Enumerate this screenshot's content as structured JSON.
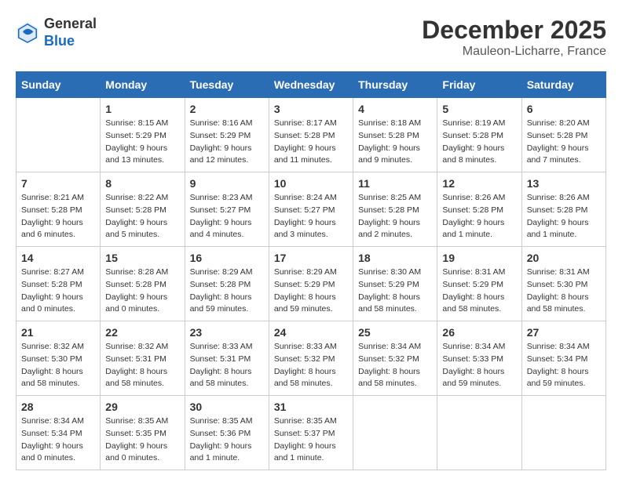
{
  "header": {
    "logo": {
      "general": "General",
      "blue": "Blue"
    },
    "month_title": "December 2025",
    "subtitle": "Mauleon-Licharre, France"
  },
  "days_of_week": [
    "Sunday",
    "Monday",
    "Tuesday",
    "Wednesday",
    "Thursday",
    "Friday",
    "Saturday"
  ],
  "weeks": [
    [
      {
        "day": "",
        "info": ""
      },
      {
        "day": "1",
        "info": "Sunrise: 8:15 AM\nSunset: 5:29 PM\nDaylight: 9 hours\nand 13 minutes."
      },
      {
        "day": "2",
        "info": "Sunrise: 8:16 AM\nSunset: 5:29 PM\nDaylight: 9 hours\nand 12 minutes."
      },
      {
        "day": "3",
        "info": "Sunrise: 8:17 AM\nSunset: 5:28 PM\nDaylight: 9 hours\nand 11 minutes."
      },
      {
        "day": "4",
        "info": "Sunrise: 8:18 AM\nSunset: 5:28 PM\nDaylight: 9 hours\nand 9 minutes."
      },
      {
        "day": "5",
        "info": "Sunrise: 8:19 AM\nSunset: 5:28 PM\nDaylight: 9 hours\nand 8 minutes."
      },
      {
        "day": "6",
        "info": "Sunrise: 8:20 AM\nSunset: 5:28 PM\nDaylight: 9 hours\nand 7 minutes."
      }
    ],
    [
      {
        "day": "7",
        "info": "Sunrise: 8:21 AM\nSunset: 5:28 PM\nDaylight: 9 hours\nand 6 minutes."
      },
      {
        "day": "8",
        "info": "Sunrise: 8:22 AM\nSunset: 5:28 PM\nDaylight: 9 hours\nand 5 minutes."
      },
      {
        "day": "9",
        "info": "Sunrise: 8:23 AM\nSunset: 5:27 PM\nDaylight: 9 hours\nand 4 minutes."
      },
      {
        "day": "10",
        "info": "Sunrise: 8:24 AM\nSunset: 5:27 PM\nDaylight: 9 hours\nand 3 minutes."
      },
      {
        "day": "11",
        "info": "Sunrise: 8:25 AM\nSunset: 5:28 PM\nDaylight: 9 hours\nand 2 minutes."
      },
      {
        "day": "12",
        "info": "Sunrise: 8:26 AM\nSunset: 5:28 PM\nDaylight: 9 hours\nand 1 minute."
      },
      {
        "day": "13",
        "info": "Sunrise: 8:26 AM\nSunset: 5:28 PM\nDaylight: 9 hours\nand 1 minute."
      }
    ],
    [
      {
        "day": "14",
        "info": "Sunrise: 8:27 AM\nSunset: 5:28 PM\nDaylight: 9 hours\nand 0 minutes."
      },
      {
        "day": "15",
        "info": "Sunrise: 8:28 AM\nSunset: 5:28 PM\nDaylight: 9 hours\nand 0 minutes."
      },
      {
        "day": "16",
        "info": "Sunrise: 8:29 AM\nSunset: 5:28 PM\nDaylight: 8 hours\nand 59 minutes."
      },
      {
        "day": "17",
        "info": "Sunrise: 8:29 AM\nSunset: 5:29 PM\nDaylight: 8 hours\nand 59 minutes."
      },
      {
        "day": "18",
        "info": "Sunrise: 8:30 AM\nSunset: 5:29 PM\nDaylight: 8 hours\nand 58 minutes."
      },
      {
        "day": "19",
        "info": "Sunrise: 8:31 AM\nSunset: 5:29 PM\nDaylight: 8 hours\nand 58 minutes."
      },
      {
        "day": "20",
        "info": "Sunrise: 8:31 AM\nSunset: 5:30 PM\nDaylight: 8 hours\nand 58 minutes."
      }
    ],
    [
      {
        "day": "21",
        "info": "Sunrise: 8:32 AM\nSunset: 5:30 PM\nDaylight: 8 hours\nand 58 minutes."
      },
      {
        "day": "22",
        "info": "Sunrise: 8:32 AM\nSunset: 5:31 PM\nDaylight: 8 hours\nand 58 minutes."
      },
      {
        "day": "23",
        "info": "Sunrise: 8:33 AM\nSunset: 5:31 PM\nDaylight: 8 hours\nand 58 minutes."
      },
      {
        "day": "24",
        "info": "Sunrise: 8:33 AM\nSunset: 5:32 PM\nDaylight: 8 hours\nand 58 minutes."
      },
      {
        "day": "25",
        "info": "Sunrise: 8:34 AM\nSunset: 5:32 PM\nDaylight: 8 hours\nand 58 minutes."
      },
      {
        "day": "26",
        "info": "Sunrise: 8:34 AM\nSunset: 5:33 PM\nDaylight: 8 hours\nand 59 minutes."
      },
      {
        "day": "27",
        "info": "Sunrise: 8:34 AM\nSunset: 5:34 PM\nDaylight: 8 hours\nand 59 minutes."
      }
    ],
    [
      {
        "day": "28",
        "info": "Sunrise: 8:34 AM\nSunset: 5:34 PM\nDaylight: 9 hours\nand 0 minutes."
      },
      {
        "day": "29",
        "info": "Sunrise: 8:35 AM\nSunset: 5:35 PM\nDaylight: 9 hours\nand 0 minutes."
      },
      {
        "day": "30",
        "info": "Sunrise: 8:35 AM\nSunset: 5:36 PM\nDaylight: 9 hours\nand 1 minute."
      },
      {
        "day": "31",
        "info": "Sunrise: 8:35 AM\nSunset: 5:37 PM\nDaylight: 9 hours\nand 1 minute."
      },
      {
        "day": "",
        "info": ""
      },
      {
        "day": "",
        "info": ""
      },
      {
        "day": "",
        "info": ""
      }
    ]
  ]
}
